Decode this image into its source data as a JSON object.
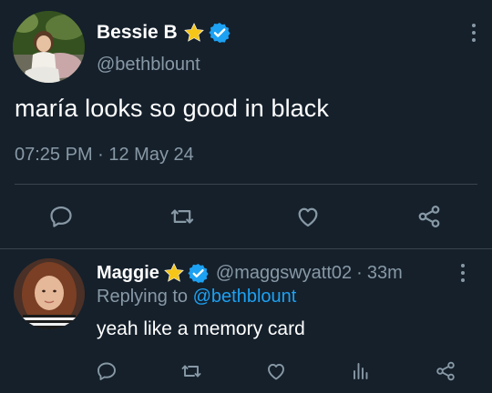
{
  "main_tweet": {
    "author_name": "Bessie B",
    "handle": "@bethblount",
    "text": "maría looks so good in black",
    "timestamp": "07:25 PM · 12 May 24",
    "icons": [
      "star-icon",
      "verified-icon",
      "more-icon",
      "reply-icon",
      "retweet-icon",
      "like-icon",
      "share-icon"
    ]
  },
  "reply": {
    "author_name": "Maggie",
    "handle": "@maggswyatt02",
    "separator": "·",
    "time_ago": "33m",
    "replying_prefix": "Replying to",
    "replying_handle": "@bethblount",
    "text": "yeah like a memory card",
    "icons": [
      "star-icon",
      "verified-icon",
      "more-icon",
      "reply-icon",
      "retweet-icon",
      "like-icon",
      "analytics-icon",
      "share-icon"
    ]
  },
  "colors": {
    "background": "#15202b",
    "text_primary": "#ffffff",
    "text_secondary": "#8899a6",
    "accent": "#1da1f2",
    "divider": "#38444d",
    "star": "#f5c518"
  }
}
